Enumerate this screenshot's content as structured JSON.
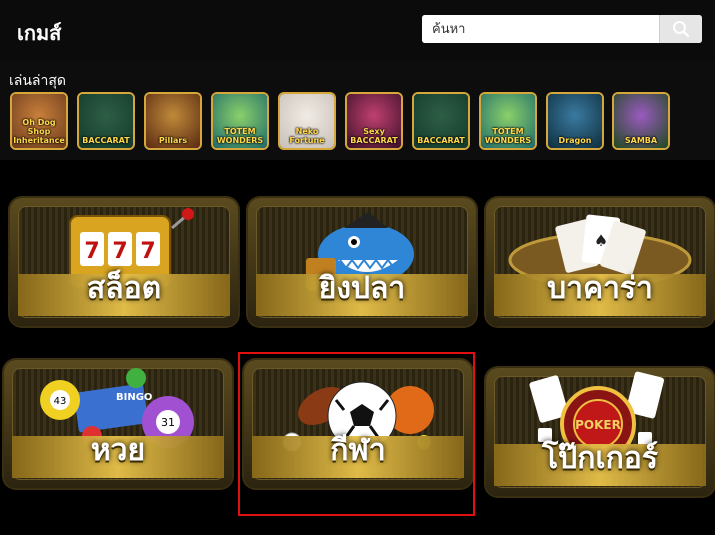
{
  "header": {
    "title": "เกมส์",
    "search_placeholder": "ค้นหา"
  },
  "recent": {
    "label": "เล่นล่าสุด",
    "games": [
      {
        "caption": "Oh Dog Shop Inheritance",
        "colors": [
          "#6b3b1e",
          "#c9803a"
        ]
      },
      {
        "caption": "BACCARAT",
        "colors": [
          "#123a2a",
          "#2e5e46"
        ]
      },
      {
        "caption": "Pillars",
        "colors": [
          "#5a2a12",
          "#c08a3a"
        ]
      },
      {
        "caption": "TOTEM WONDERS",
        "colors": [
          "#1f6a6a",
          "#8ad06a"
        ]
      },
      {
        "caption": "Neko Fortune",
        "colors": [
          "#c8c0b8",
          "#f0ebe4"
        ]
      },
      {
        "caption": "Sexy BACCARAT",
        "colors": [
          "#3a1028",
          "#c04070"
        ]
      },
      {
        "caption": "BACCARAT",
        "colors": [
          "#123a2a",
          "#2e5e46"
        ]
      },
      {
        "caption": "TOTEM WONDERS",
        "colors": [
          "#1f6a6a",
          "#8ad06a"
        ]
      },
      {
        "caption": "Dragon",
        "colors": [
          "#0e2e3e",
          "#3a7aa0"
        ]
      },
      {
        "caption": "SAMBA",
        "colors": [
          "#1e4a1e",
          "#9a5ac0"
        ]
      }
    ]
  },
  "categories": [
    {
      "name": "slots",
      "label": "สล็อต",
      "icon": "slot-machine-icon"
    },
    {
      "name": "fishing",
      "label": "ยิงปลา",
      "icon": "shark-icon"
    },
    {
      "name": "baccarat",
      "label": "บาคาร่า",
      "icon": "playing-cards-icon"
    },
    {
      "name": "lottery",
      "label": "หวย",
      "icon": "lottery-balls-icon"
    },
    {
      "name": "sports",
      "label": "กีฬา",
      "icon": "soccer-ball-icon",
      "selected": true
    },
    {
      "name": "poker",
      "label": "โป๊กเกอร์",
      "icon": "poker-chip-icon"
    }
  ],
  "colors": {
    "accent_gold": "#d6a73a",
    "selection": "#e01010"
  }
}
